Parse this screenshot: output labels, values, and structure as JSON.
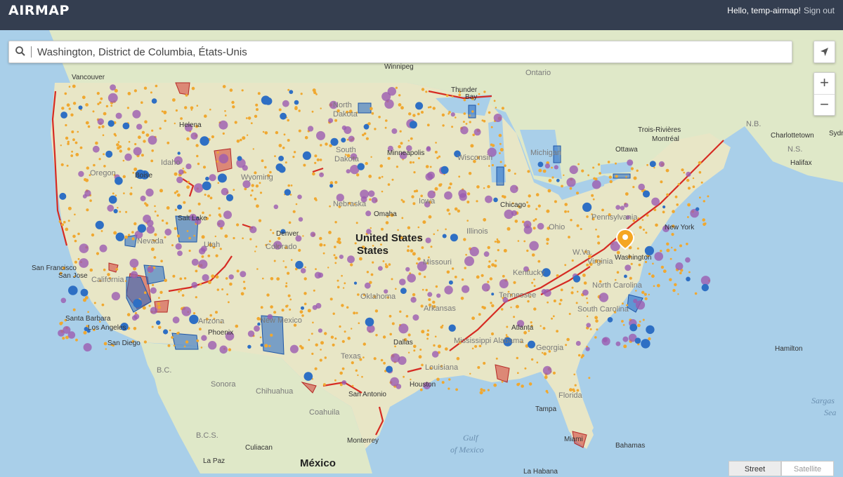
{
  "app": {
    "logo": "AIRMAP",
    "greeting": "Hello, temp-airmap!",
    "signout": "Sign out"
  },
  "search": {
    "value": "Washington, District de Columbia, États-Unis"
  },
  "controls": {
    "zoom_in": "+",
    "zoom_out": "−",
    "locate_icon": "navigation-arrow-icon"
  },
  "map_toggle": {
    "street": "Street",
    "satellite": "Satellite",
    "active": "street"
  },
  "colors": {
    "topbar": "#343e50",
    "water": "#a9cfe9",
    "land": "#dfe8c8",
    "restricted": "#d23a35",
    "controlled": "#2e6fc4",
    "heliport": "#9b5bb0",
    "airport": "#f0a830",
    "marker": "#f5a623"
  },
  "labels": {
    "country": {
      "us": "United States",
      "us2": "States",
      "mexico": "México"
    },
    "cities": {
      "vancouver": "Vancouver",
      "winnipeg": "Winnipeg",
      "thunder_bay": "Thunder",
      "thunder_bay2": "Bay",
      "ontario": "Ontario",
      "helena": "Helena",
      "minneapolis": "Minneapolis",
      "ottawa": "Ottawa",
      "montreal": "Montréal",
      "trois_rivieres": "Trois-Rivières",
      "charlottetown": "Charlottetown",
      "halifax": "Halifax",
      "chicago": "Chicago",
      "omaha": "Omaha",
      "denver": "Denver",
      "new_york": "New York",
      "washington": "Washington",
      "san_francisco": "San Francisco",
      "san_jose": "San Jose",
      "santa_barbara": "Santa Barbara",
      "los_angeles": "Los Angeles",
      "san_diego": "San Diego",
      "phoenix": "Phoenix",
      "dallas": "Dallas",
      "atlanta": "Atlanta",
      "houston": "Houston",
      "san_antonio": "San Antonio",
      "tampa": "Tampa",
      "miami": "Miami",
      "monterrey": "Monterrey",
      "culiacan": "Culiacan",
      "la_paz": "La Paz",
      "bahamas": "Bahamas",
      "hamilton": "Hamilton",
      "la_habana": "La Habana",
      "salt_lake": "Salt Lake",
      "boise": "Boise"
    },
    "states": {
      "oregon": "Oregon",
      "idaho": "Idaho",
      "wyoming": "Wyoming",
      "north_dakota": "North",
      "north_dakota2": "Dakota",
      "south_dakota": "South",
      "south_dakota2": "Dakota",
      "nebraska": "Nebraska",
      "nevada": "Nevada",
      "utah": "Utah",
      "colorado": "Colorado",
      "california": "California",
      "arizona": "Arizona",
      "new_mexico": "New Mexico",
      "oklahoma": "Oklahoma",
      "arkansas": "Arkansas",
      "missouri": "Missouri",
      "iowa": "Iowa",
      "illinois": "Illinois",
      "ohio": "Ohio",
      "kentucky": "Kentucky",
      "tennessee": "Tennessee",
      "mississippi": "Mississippi",
      "alabama": "Alabama",
      "georgia": "Georgia",
      "louisiana": "Louisiana",
      "texas": "Texas",
      "florida": "Florida",
      "wisconsin": "Wisconsin",
      "michigan": "Michigan",
      "pennsylvania": "Pennsylvania",
      "wv": "W.Va.",
      "nc": "North Carolina",
      "sc": "South Carolina",
      "sonora": "Sonora",
      "chihuahua": "Chihuahua",
      "coahuila": "Coahuila",
      "bc": "B.C.",
      "bcs": "B.C.S.",
      "nb": "N.B.",
      "ns": "N.S.",
      "sydney": "Sydn",
      "virginia": "Virginia"
    },
    "water": {
      "gulf": "Gulf",
      "gulf2": "of Mexico",
      "sargasso": "Sargas",
      "sargasso2": "Sea"
    }
  }
}
